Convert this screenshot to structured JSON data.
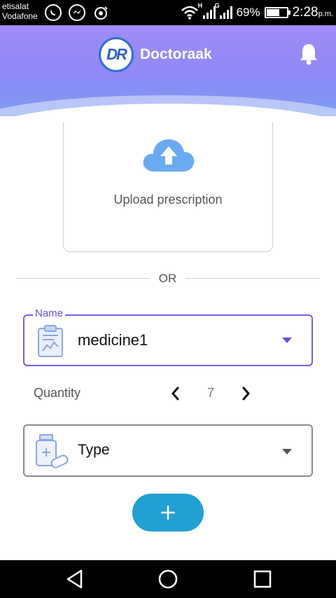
{
  "status_bar": {
    "carrier_1": "etisalat",
    "carrier_2": "Vodafone",
    "network_1": "H",
    "network_2": "G",
    "battery_percent": "69%",
    "battery_level": 0.69,
    "time": "2:28",
    "time_suffix": "p.m.",
    "icons": [
      "whatsapp-icon",
      "messenger-icon",
      "alarm-icon",
      "wifi-icon",
      "signal-icon",
      "signal-icon",
      "battery-icon"
    ]
  },
  "header": {
    "logo_text": "DR",
    "app_name": "Doctoraak",
    "icons": [
      "logo-icon",
      "bell-icon"
    ],
    "colors": {
      "gradient_top": "#a08af7",
      "gradient_bottom": "#7a9cf3"
    }
  },
  "upload": {
    "label": "Upload prescription",
    "icon": "cloud-upload-icon",
    "icon_color": "#6aaaf0"
  },
  "divider": {
    "text": "OR"
  },
  "form": {
    "name_field": {
      "label": "Name",
      "value": "medicine1",
      "icon": "clipboard-chart-icon",
      "accent": "#7c5ce6"
    },
    "quantity": {
      "label": "Quantity",
      "value": "7",
      "icons": [
        "chevron-left-icon",
        "chevron-right-icon"
      ]
    },
    "type_field": {
      "value": "Type",
      "icon": "pill-bottle-icon"
    },
    "add_button": {
      "icon": "plus-icon",
      "color": "#21a0d3"
    }
  },
  "nav_bar": {
    "icons": [
      "back-icon",
      "home-icon",
      "recents-icon"
    ]
  }
}
